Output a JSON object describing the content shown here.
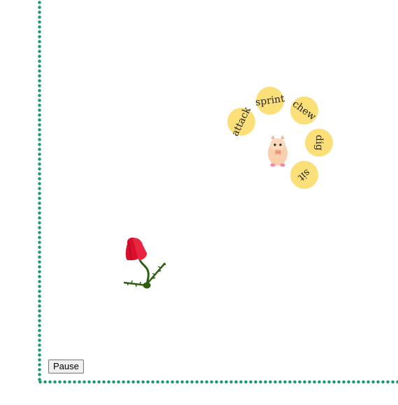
{
  "game": {
    "actions": [
      {
        "label": "attack"
      },
      {
        "label": "sprint"
      },
      {
        "label": "chew"
      },
      {
        "label": "dig"
      },
      {
        "label": "sit"
      }
    ],
    "pause_label": "Pause",
    "character_icon": "pig-icon",
    "item_icon": "rose-icon"
  },
  "colors": {
    "border_dots": "#1a9a6e",
    "action_bubble": "#fbe07a",
    "pig_body": "#f9cfae",
    "rose_petal": "#d8102c",
    "rose_stem": "#2e5f10"
  }
}
